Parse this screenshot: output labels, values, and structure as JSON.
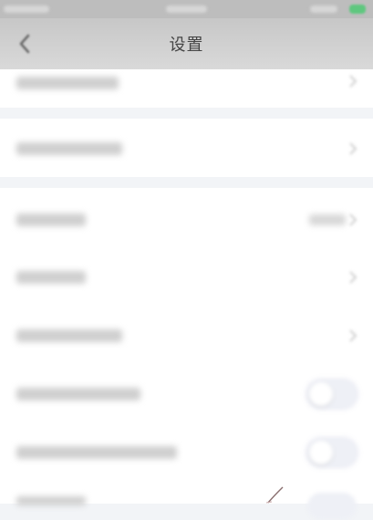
{
  "nav": {
    "title": "设置",
    "back_icon": "back-arrow-icon"
  },
  "rows": [
    {
      "name": "row-1",
      "control": "chevron"
    },
    {
      "name": "row-2",
      "control": "chevron"
    },
    {
      "name": "row-3",
      "control": "chevron-with-value"
    },
    {
      "name": "row-4",
      "control": "chevron"
    },
    {
      "name": "row-5",
      "control": "chevron"
    },
    {
      "name": "row-6",
      "control": "toggle",
      "on": false
    },
    {
      "name": "row-7",
      "control": "toggle",
      "on": false
    }
  ],
  "colors": {
    "status_bar": "#bdbdbd",
    "nav_bar": "#cfcfcf",
    "background": "#f2f4f7",
    "battery": "#5fc77f"
  }
}
